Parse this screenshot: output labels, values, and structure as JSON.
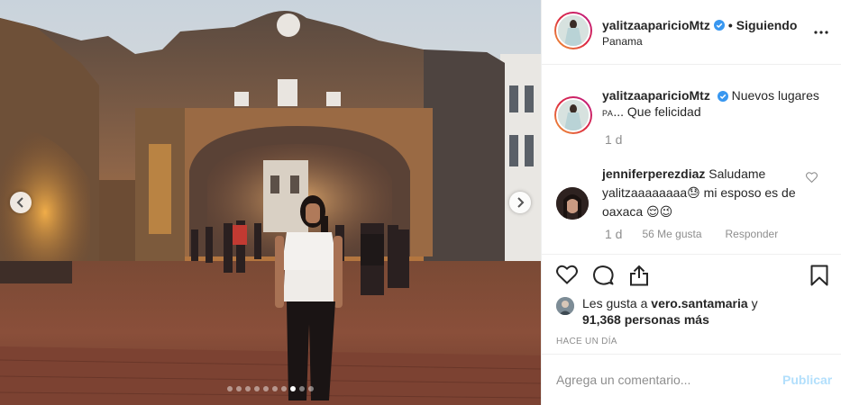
{
  "post": {
    "author": {
      "username": "yalitzaaparicioMtz",
      "verified": true,
      "follow_status": "Siguiendo",
      "separator": "•",
      "location": "Panama"
    },
    "caption": {
      "username": "yalitzaaparicioMtz",
      "text_part1": "Nuevos lugares",
      "text_small": "PA",
      "text_part2": "... Que felicidad",
      "time": "1 d"
    },
    "comments": [
      {
        "username": "jenniferperezdiaz",
        "text": "Saludame yalitzaaaaaaaa😓 mi esposo es de oaxaca 😌😉",
        "time": "1 d",
        "likes": "56 Me gusta",
        "reply_label": "Responder"
      }
    ],
    "likes": {
      "prefix": "Les gusta a ",
      "user": "vero.santamaria",
      "suffix": " y",
      "others": "91,368 personas más"
    },
    "time_ago": "HACE UN DÍA",
    "add_comment": {
      "placeholder": "Agrega un comentario...",
      "post_label": "Publicar"
    },
    "carousel": {
      "total": 10,
      "active_index": 7
    }
  },
  "icons": {
    "verified": "verified-badge-icon",
    "more": "more-options-icon",
    "like": "heart-icon",
    "comment": "comment-bubble-icon",
    "share": "share-icon",
    "save": "bookmark-icon",
    "prev": "chevron-left-icon",
    "next": "chevron-right-icon"
  },
  "colors": {
    "verified": "#3897f0",
    "post_button_disabled": "#b2dffc",
    "muted_text": "#8e8e8e"
  }
}
